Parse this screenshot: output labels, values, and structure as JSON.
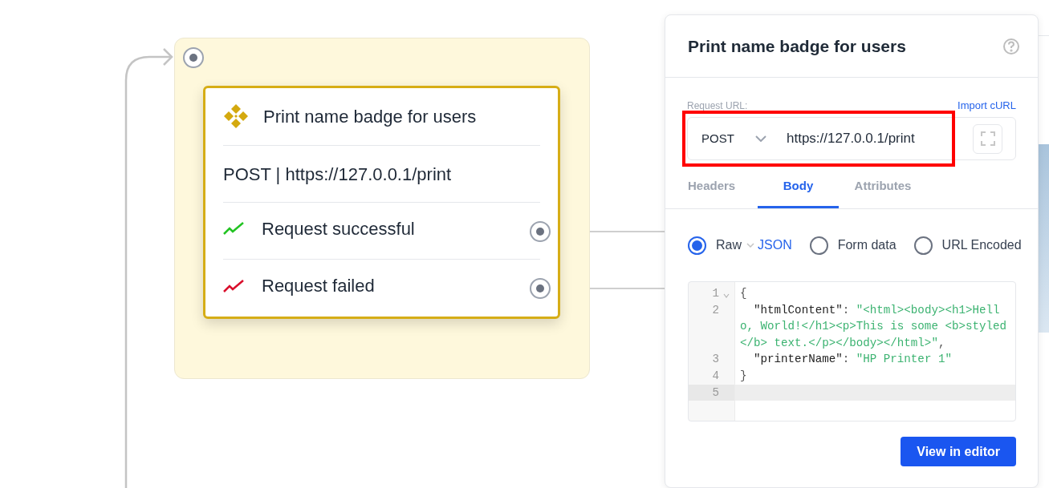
{
  "canvas": {
    "node": {
      "title": "Print name badge for users",
      "request": "POST | https://127.0.0.1/print",
      "outcomes": [
        {
          "kind": "success",
          "label": "Request successful"
        },
        {
          "kind": "failure",
          "label": "Request failed"
        }
      ]
    }
  },
  "panel": {
    "title": "Print name badge for users",
    "url_label": "Request URL:",
    "import_link": "Import cURL",
    "method": "POST",
    "url": "https://127.0.0.1/print",
    "url_highlighted": true,
    "tabs": [
      {
        "label": "Headers",
        "selected": false
      },
      {
        "label": "Body",
        "selected": true
      },
      {
        "label": "Attributes",
        "selected": false
      }
    ],
    "body_types": [
      {
        "label": "Raw",
        "selected": true,
        "format": "JSON"
      },
      {
        "label": "Form data",
        "selected": false
      },
      {
        "label": "URL Encoded",
        "selected": false
      }
    ],
    "code_lines": [
      {
        "number": "1",
        "foldable": true,
        "active": false,
        "tokens": [
          {
            "kind": "punct",
            "text": "{"
          }
        ]
      },
      {
        "number": "2",
        "foldable": false,
        "active": false,
        "tokens": [
          {
            "kind": "key",
            "text": "  \"htmlContent\""
          },
          {
            "kind": "punct",
            "text": ": "
          },
          {
            "kind": "string",
            "text": "\"<html><body><h1>Hello, World!</h1><p>This is some <b>styled</b> text.</p></body></html>\""
          },
          {
            "kind": "punct",
            "text": ","
          }
        ]
      },
      {
        "number": "3",
        "foldable": false,
        "active": false,
        "tokens": [
          {
            "kind": "key",
            "text": "  \"printerName\""
          },
          {
            "kind": "punct",
            "text": ": "
          },
          {
            "kind": "string",
            "text": "\"HP Printer 1\""
          }
        ]
      },
      {
        "number": "4",
        "foldable": false,
        "active": false,
        "tokens": [
          {
            "kind": "punct",
            "text": "}"
          }
        ]
      },
      {
        "number": "5",
        "foldable": false,
        "active": true
      }
    ],
    "button": "View in editor"
  }
}
